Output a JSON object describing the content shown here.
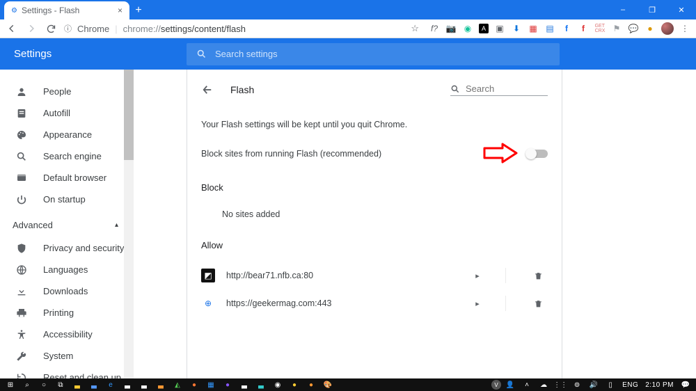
{
  "window": {
    "tab_title": "Settings - Flash",
    "minimize": "–",
    "maximize": "❐",
    "close": "✕"
  },
  "addr": {
    "origin_label": "Chrome",
    "url_proto": "chrome://",
    "url_path": "settings/content/flash"
  },
  "top_search": {
    "placeholder": "Search settings"
  },
  "settings_title": "Settings",
  "sidebar": {
    "items": [
      {
        "icon": "person",
        "label": "People"
      },
      {
        "icon": "autofill",
        "label": "Autofill"
      },
      {
        "icon": "appearance",
        "label": "Appearance"
      },
      {
        "icon": "search",
        "label": "Search engine"
      },
      {
        "icon": "default",
        "label": "Default browser"
      },
      {
        "icon": "startup",
        "label": "On startup"
      }
    ],
    "advanced": "Advanced",
    "adv_items": [
      {
        "icon": "shield",
        "label": "Privacy and security"
      },
      {
        "icon": "globe",
        "label": "Languages"
      },
      {
        "icon": "download",
        "label": "Downloads"
      },
      {
        "icon": "printer",
        "label": "Printing"
      },
      {
        "icon": "a11y",
        "label": "Accessibility"
      },
      {
        "icon": "wrench",
        "label": "System"
      },
      {
        "icon": "restore",
        "label": "Reset and clean up"
      }
    ]
  },
  "page": {
    "title": "Flash",
    "search_placeholder": "Search",
    "notice": "Your Flash settings will be kept until you quit Chrome.",
    "toggle_label": "Block sites from running Flash (recommended)",
    "toggle_on": false,
    "block_h": "Block",
    "block_empty": "No sites added",
    "allow_h": "Allow",
    "allow": [
      {
        "url": "http://bear71.nfb.ca:80"
      },
      {
        "url": "https://geekermag.com:443"
      }
    ]
  },
  "tray": {
    "lang": "ENG",
    "time": "2:10 PM"
  }
}
